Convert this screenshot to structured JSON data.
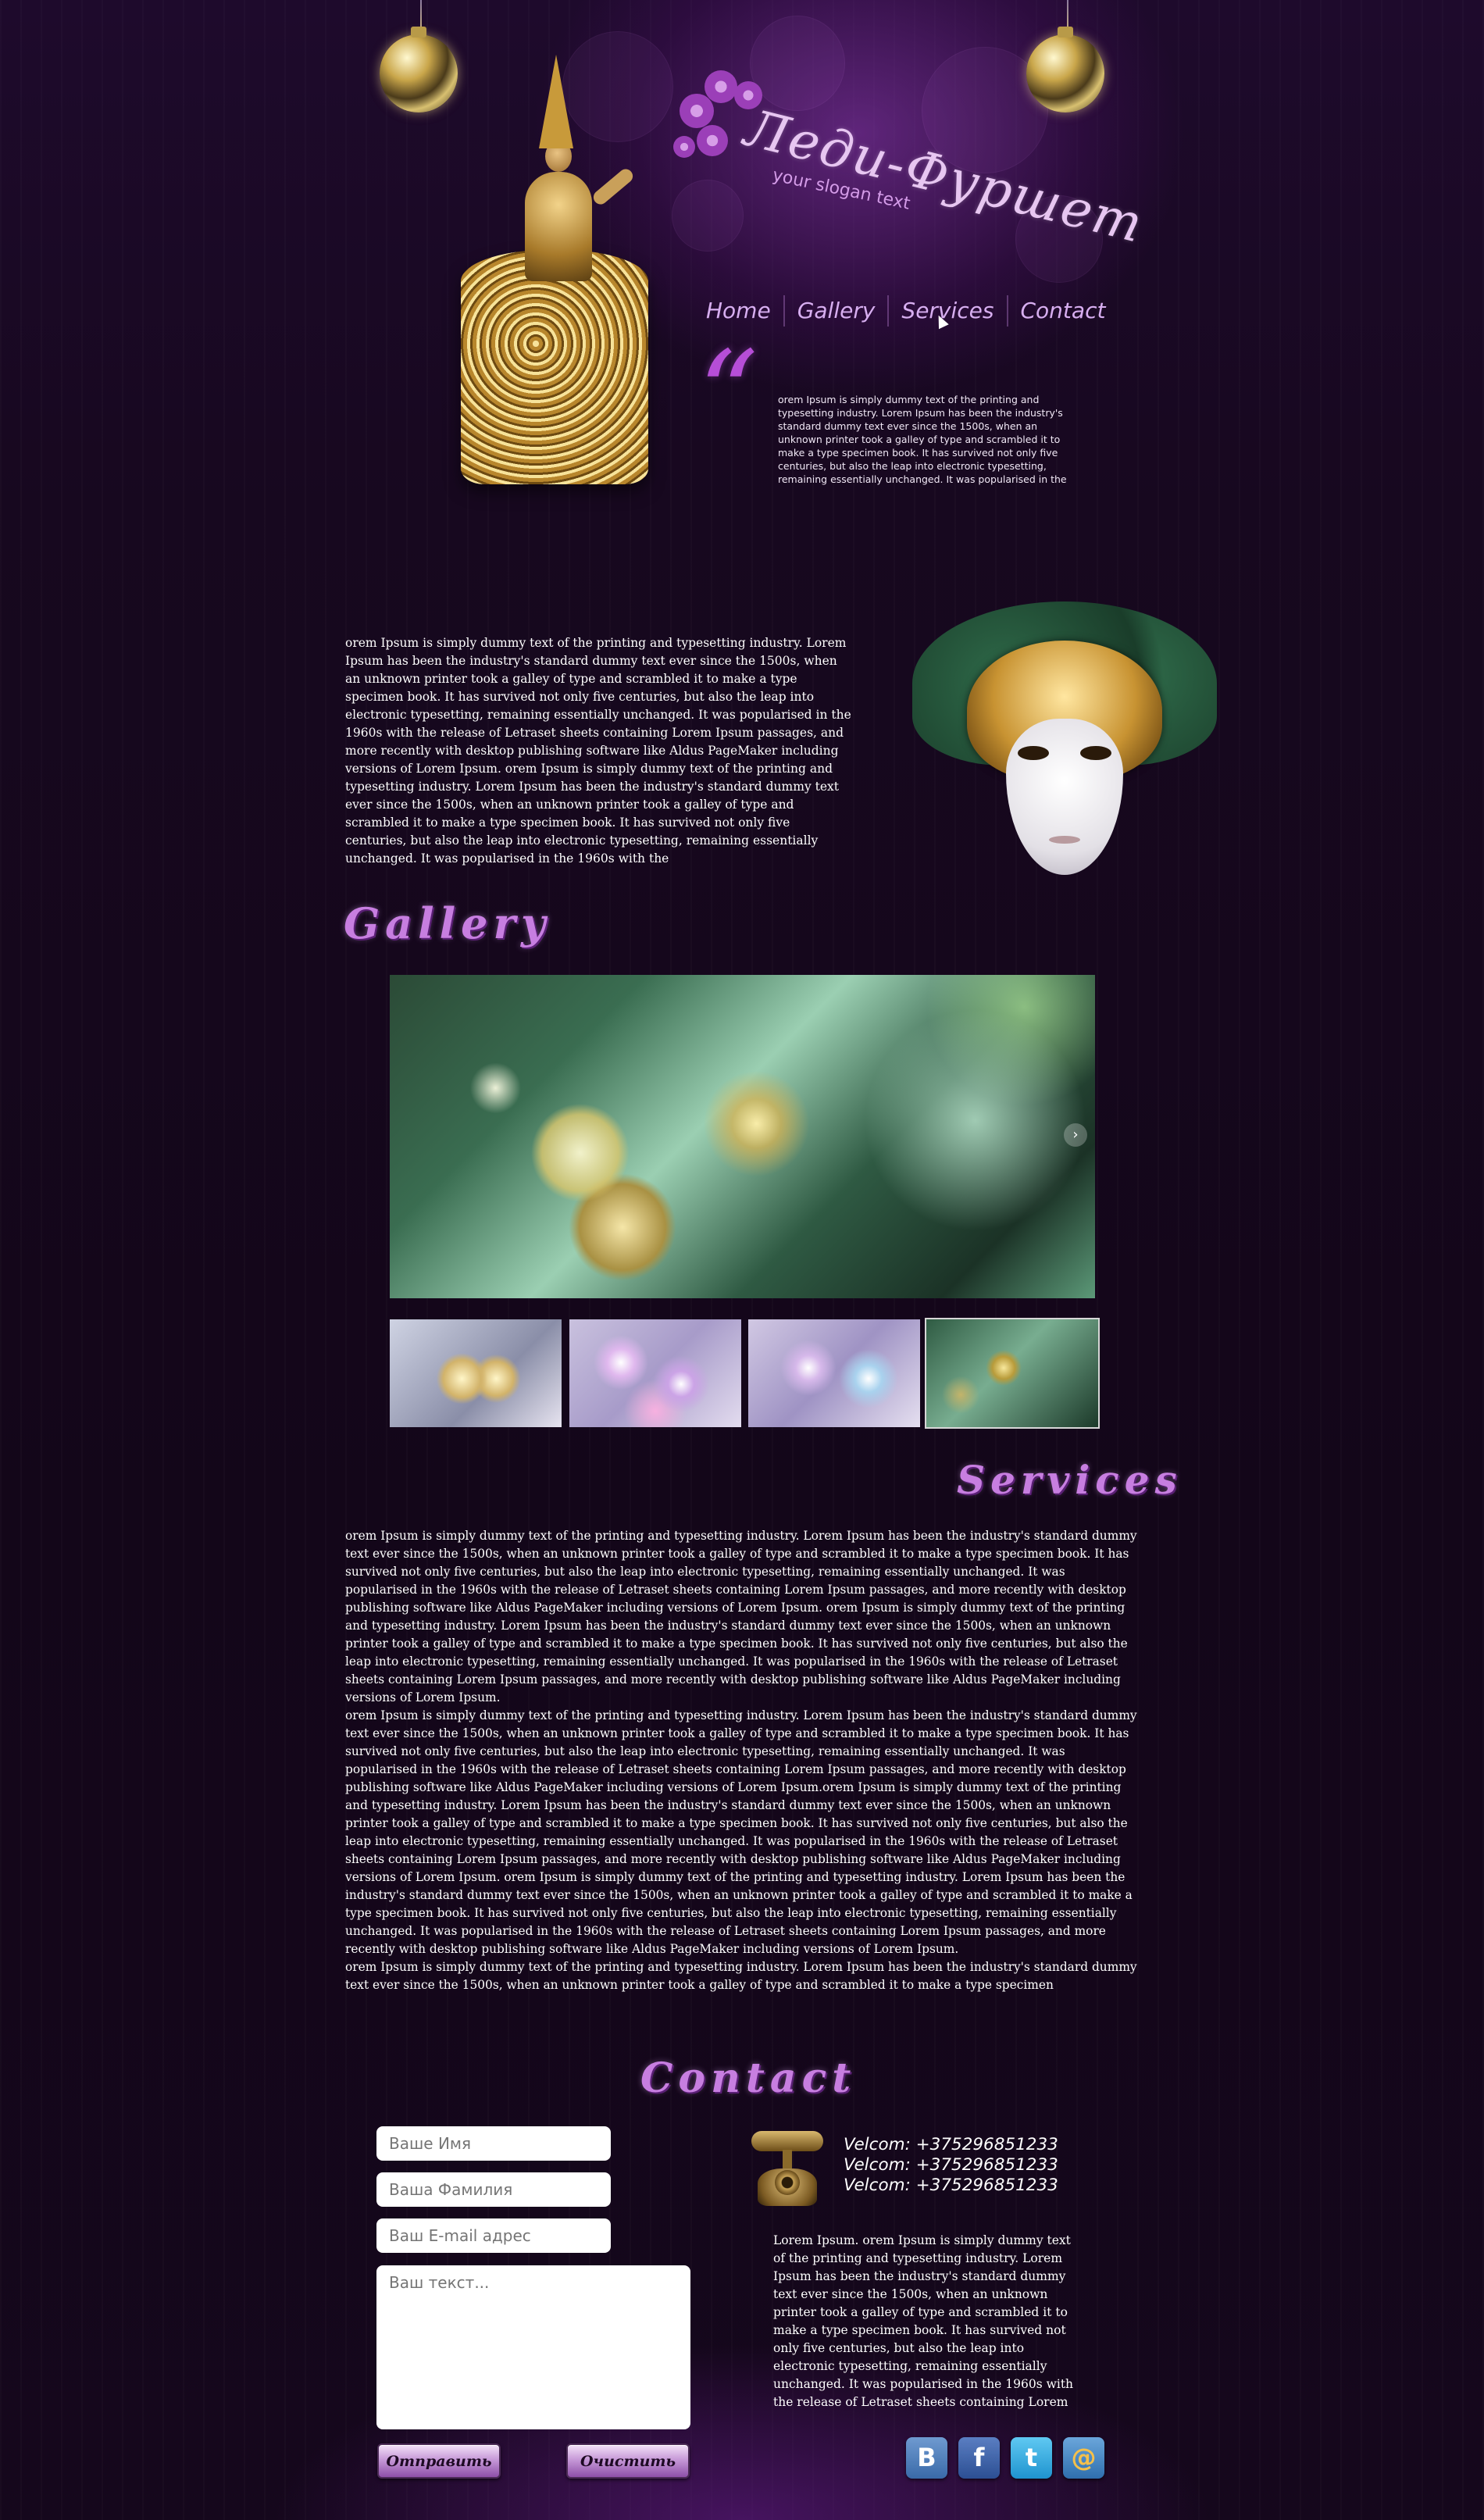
{
  "logo": {
    "title": "Леди-Фуршет",
    "slogan": "your slogan text"
  },
  "nav": {
    "items": [
      "Home",
      "Gallery",
      "Services",
      "Contact"
    ]
  },
  "quote": {
    "mark": "“",
    "text": "orem Ipsum is simply dummy text of the printing and typesetting industry. Lorem Ipsum has been the industry's standard dummy text ever since the 1500s, when an unknown printer took a galley of type and scrambled it to make a type specimen book. It has survived not only five centuries, but also the leap into electronic typesetting, remaining essentially unchanged. It was popularised in the"
  },
  "intro": {
    "text": "orem Ipsum is simply dummy text of the printing and typesetting industry. Lorem Ipsum has been the industry's standard dummy text ever since the 1500s, when an unknown printer took a galley of type and scrambled it to make a type specimen book. It has survived not only five centuries, but also the leap into electronic typesetting, remaining essentially unchanged. It was popularised in the 1960s with the release of Letraset sheets containing Lorem Ipsum passages, and more recently with desktop publishing software like Aldus PageMaker including versions of Lorem Ipsum. orem Ipsum is simply dummy text of the printing and typesetting industry. Lorem Ipsum has been the industry's standard dummy text ever since the 1500s, when an unknown printer took a galley of type and scrambled it to make a type specimen book. It has survived not only five centuries, but also the leap into electronic typesetting, remaining essentially unchanged. It was popularised in the 1960s with the"
  },
  "gallery": {
    "heading": "Gallery",
    "next_arrow": "›"
  },
  "services": {
    "heading": "Services",
    "paragraphs": [
      "orem Ipsum is simply dummy text of the printing and typesetting industry. Lorem Ipsum has been the industry's standard dummy text ever since the 1500s, when an unknown printer took a galley of type and scrambled it to make a type specimen book. It has survived not only five centuries, but also the leap into electronic typesetting, remaining essentially unchanged. It was popularised in the 1960s with the release of Letraset sheets containing Lorem Ipsum passages, and more recently with desktop publishing software like Aldus PageMaker including versions of Lorem Ipsum. orem Ipsum is simply dummy text of the printing and typesetting industry. Lorem Ipsum has been the industry's standard dummy text ever since the 1500s, when an unknown printer took a galley of type and scrambled it to make a type specimen book. It has survived not only five centuries, but also the leap into electronic typesetting, remaining essentially unchanged. It was popularised in the 1960s with the release of Letraset sheets containing Lorem Ipsum passages, and more recently with desktop publishing software like Aldus PageMaker including versions of Lorem Ipsum.",
      "orem Ipsum is simply dummy text of the printing and typesetting industry. Lorem Ipsum has been the industry's standard dummy text ever since the 1500s, when an unknown printer took a galley of type and scrambled it to make a type specimen book. It has survived not only five centuries, but also the leap into electronic typesetting, remaining essentially unchanged. It was popularised in the 1960s with the release of Letraset sheets containing Lorem Ipsum passages, and more recently with desktop publishing software like Aldus PageMaker including versions of Lorem Ipsum.orem Ipsum is simply dummy text of the printing and typesetting industry. Lorem Ipsum has been the industry's standard dummy text ever since the 1500s, when an unknown printer took a galley of type and scrambled it to make a type specimen book. It has survived not only five centuries, but also the leap into electronic typesetting, remaining essentially unchanged. It was popularised in the 1960s with the release of Letraset sheets containing Lorem Ipsum passages, and more recently with desktop publishing software like Aldus PageMaker including versions of Lorem Ipsum. orem Ipsum is simply dummy text of the printing and typesetting industry. Lorem Ipsum has been the industry's standard dummy text ever since the 1500s, when an unknown printer took a galley of type and scrambled it to make a type specimen book. It has survived not only five centuries, but also the leap into electronic typesetting, remaining essentially unchanged. It was popularised in the 1960s with the release of Letraset sheets containing Lorem Ipsum passages, and more recently with desktop publishing software like Aldus PageMaker including versions of Lorem Ipsum.",
      "orem Ipsum is simply dummy text of the printing and typesetting industry. Lorem Ipsum has been the industry's standard dummy text ever since the 1500s, when an unknown printer took a galley of type and scrambled it to make a type specimen"
    ]
  },
  "contact": {
    "heading": "Contact",
    "form": {
      "name_placeholder": "Ваше Имя",
      "surname_placeholder": "Ваша Фамилия",
      "email_placeholder": "Ваш E-mail адрес",
      "message_placeholder": "Ваш текст...",
      "send_label": "Отправить",
      "clear_label": "Очистить"
    },
    "phones": [
      "Velcom: +375296851233",
      "Velcom: +375296851233",
      "Velcom: +375296851233"
    ],
    "text": "Lorem Ipsum. orem Ipsum is simply dummy text of the printing and typesetting industry. Lorem Ipsum has been the industry's standard dummy text ever since the 1500s, when an unknown printer took a galley of type and scrambled it to make a type specimen book. It has survived not only five centuries, but also the leap into electronic typesetting, remaining essentially unchanged. It was popularised in the 1960s with the release of Letraset sheets containing Lorem",
    "social": [
      {
        "name": "vk-icon",
        "glyph": "B"
      },
      {
        "name": "facebook-icon",
        "glyph": "f"
      },
      {
        "name": "twitter-icon",
        "glyph": "t"
      },
      {
        "name": "mail-icon",
        "glyph": "@"
      }
    ]
  }
}
